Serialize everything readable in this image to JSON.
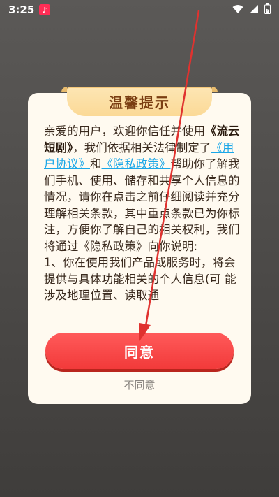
{
  "status_bar": {
    "time": "3:25",
    "notification_icon": "music-note-icon",
    "icons": [
      "wifi-icon",
      "signal-icon",
      "battery-icon"
    ]
  },
  "dialog": {
    "title": "温馨提示",
    "paragraph": {
      "part1": "亲爱的用户，欢迎你信任并使用",
      "app_name": "《流云短剧》",
      "part2": "，我们依据相关法律制定了",
      "link_user_agreement": "《用户协议》",
      "part3": "和",
      "link_privacy": "《隐私政策》",
      "part4": "帮助你了解我们手机、使用、储存和共享个人信息的情况，请你在点击之前仔细阅读并充分理解相关条款，其中重点条款已为你标注，方便你了解自己的相关权利，我们将通过《隐私政策》向你说明:",
      "item1": " 1、你在使用我们产品或服务时，将会提供与具体功能相关的个人信息(可 能涉及地理位置、读取通"
    },
    "agree_label": "同意",
    "disagree_label": "不同意"
  },
  "colors": {
    "accent_red": "#f23a3a",
    "link_blue": "#1aa7e8",
    "title_brown": "#7a3e12",
    "annotation_arrow": "#e0322f"
  }
}
